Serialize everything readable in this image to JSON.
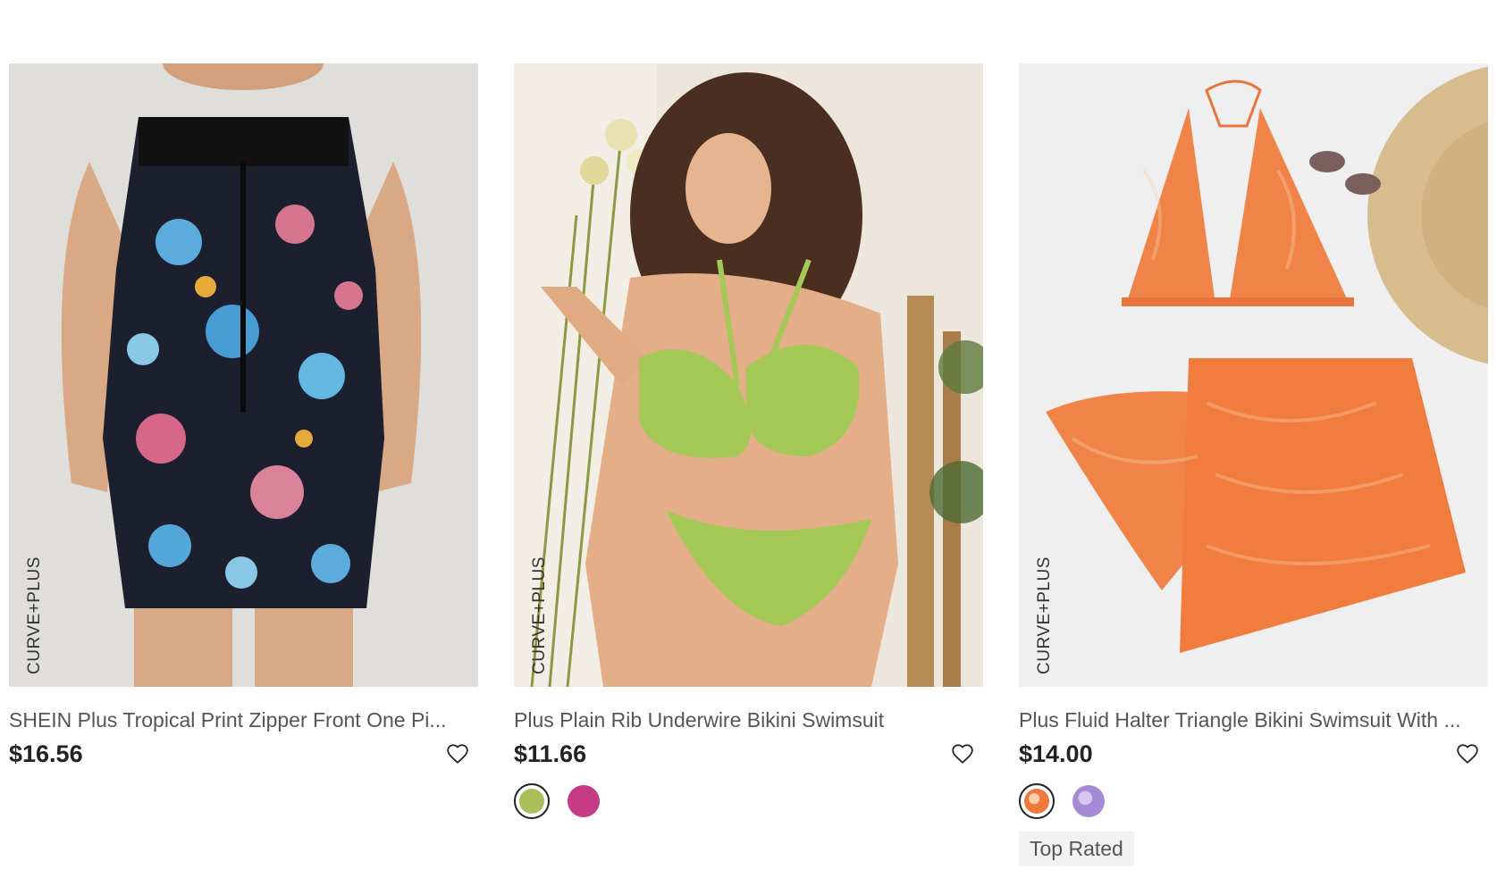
{
  "products": [
    {
      "brand_tag": "CURVE+PLUS",
      "title": "SHEIN Plus Tropical Print Zipper Front One Pi...",
      "price": "$16.56",
      "swatches": [],
      "badge": ""
    },
    {
      "brand_tag": "CURVE+PLUS",
      "title": "Plus Plain Rib Underwire Bikini Swimsuit",
      "price": "$11.66",
      "swatches": [
        {
          "color": "#a9bf5a",
          "selected": true
        },
        {
          "color": "#c73a84",
          "selected": false
        }
      ],
      "badge": ""
    },
    {
      "brand_tag": "CURVE+PLUS",
      "title": "Plus Fluid Halter Triangle Bikini Swimsuit With ...",
      "price": "$14.00",
      "swatches": [
        {
          "color": "#f07a3c",
          "selected": true
        },
        {
          "color": "#a58ad6",
          "selected": false
        }
      ],
      "badge": "Top Rated"
    }
  ],
  "icons": {
    "wishlist": "heart-outline-icon"
  },
  "colors": {
    "price": "#222222",
    "title": "#555555",
    "badge_bg": "#f2f2f2"
  }
}
